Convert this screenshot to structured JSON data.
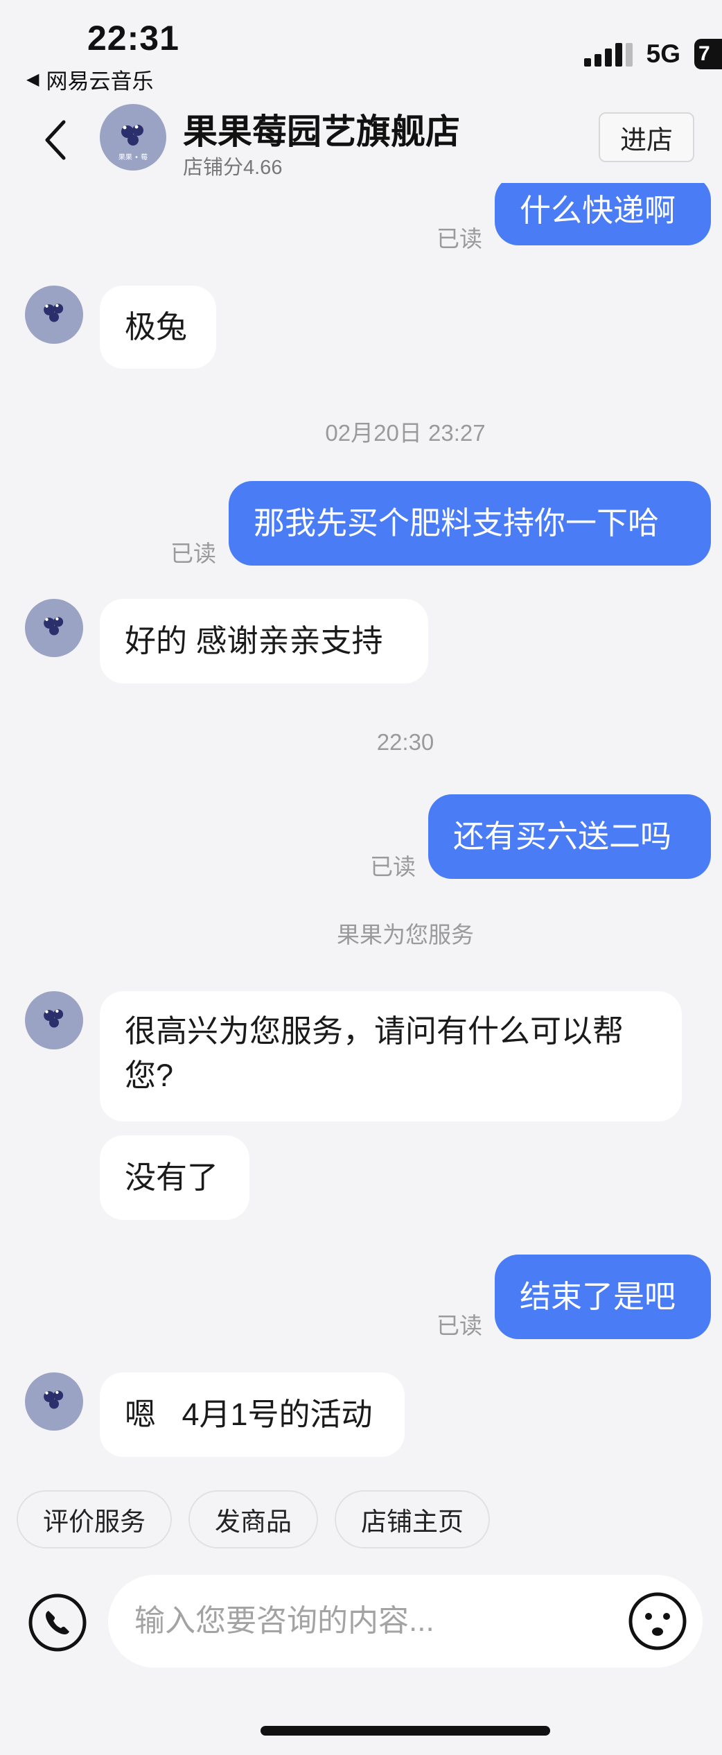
{
  "status_bar": {
    "time": "22:31",
    "back_app": "网易云音乐",
    "back_app_icon": "triangle-left-icon",
    "network": "5G",
    "battery": "7"
  },
  "header": {
    "shop_name": "果果莓园艺旗舰店",
    "shop_score": "店铺分4.66",
    "enter_label": "进店",
    "avatar_text": "果果 • 莓"
  },
  "messages": {
    "m1": {
      "text": "什么快递啊",
      "status": "已读"
    },
    "m2": {
      "text": "极兔"
    },
    "t1": "02月20日 23:27",
    "m3": {
      "text": "那我先买个肥料支持你一下哈",
      "status": "已读"
    },
    "m4": {
      "text": "好的 感谢亲亲支持"
    },
    "t2": "22:30",
    "m5": {
      "text": "还有买六送二吗",
      "status": "已读"
    },
    "service_notice": "果果为您服务",
    "m6": {
      "text": "很高兴为您服务，请问有什么可以帮您?"
    },
    "m7": {
      "text": "没有了"
    },
    "m8": {
      "text": "结束了是吧",
      "status": "已读"
    },
    "m9": {
      "text": "嗯   4月1号的活动"
    }
  },
  "quick_actions": [
    "评价服务",
    "发商品",
    "店铺主页"
  ],
  "input": {
    "placeholder": "输入您要咨询的内容...",
    "voice_icon": "phone-icon",
    "emoji_icon": "smiley-icon"
  },
  "colors": {
    "accent": "#4a7cf6",
    "background": "#f4f4f6",
    "avatar": "#9aa3c4"
  }
}
